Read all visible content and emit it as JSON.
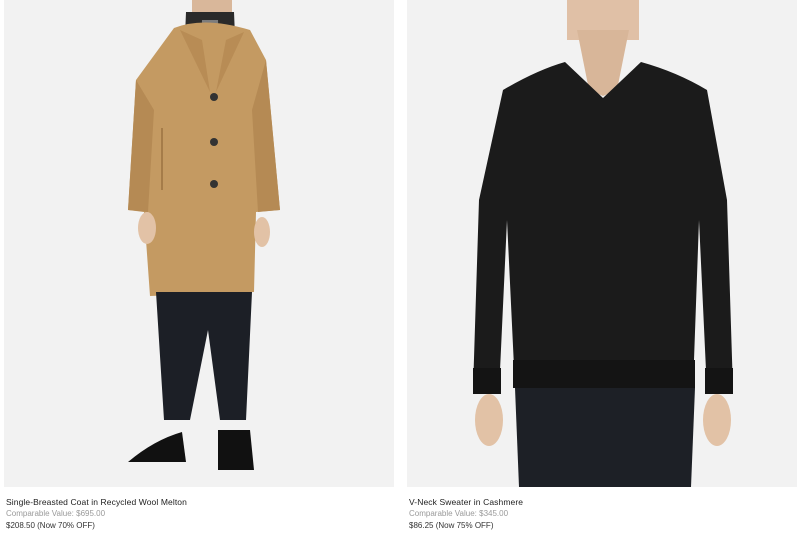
{
  "products": [
    {
      "name": "Single-Breasted Coat in Recycled Wool Melton",
      "comparable_value": "Comparable Value: $695.00",
      "price": "$208.50 (Now 70% OFF)"
    },
    {
      "name": "V-Neck Sweater in Cashmere",
      "comparable_value": "Comparable Value: $345.00",
      "price": "$86.25 (Now 75% OFF)"
    }
  ],
  "colors": {
    "image_background": "#f2f2f2",
    "coat": "#c49a62",
    "sweater": "#1b1b1b",
    "muted_text": "#9a9a9a"
  }
}
